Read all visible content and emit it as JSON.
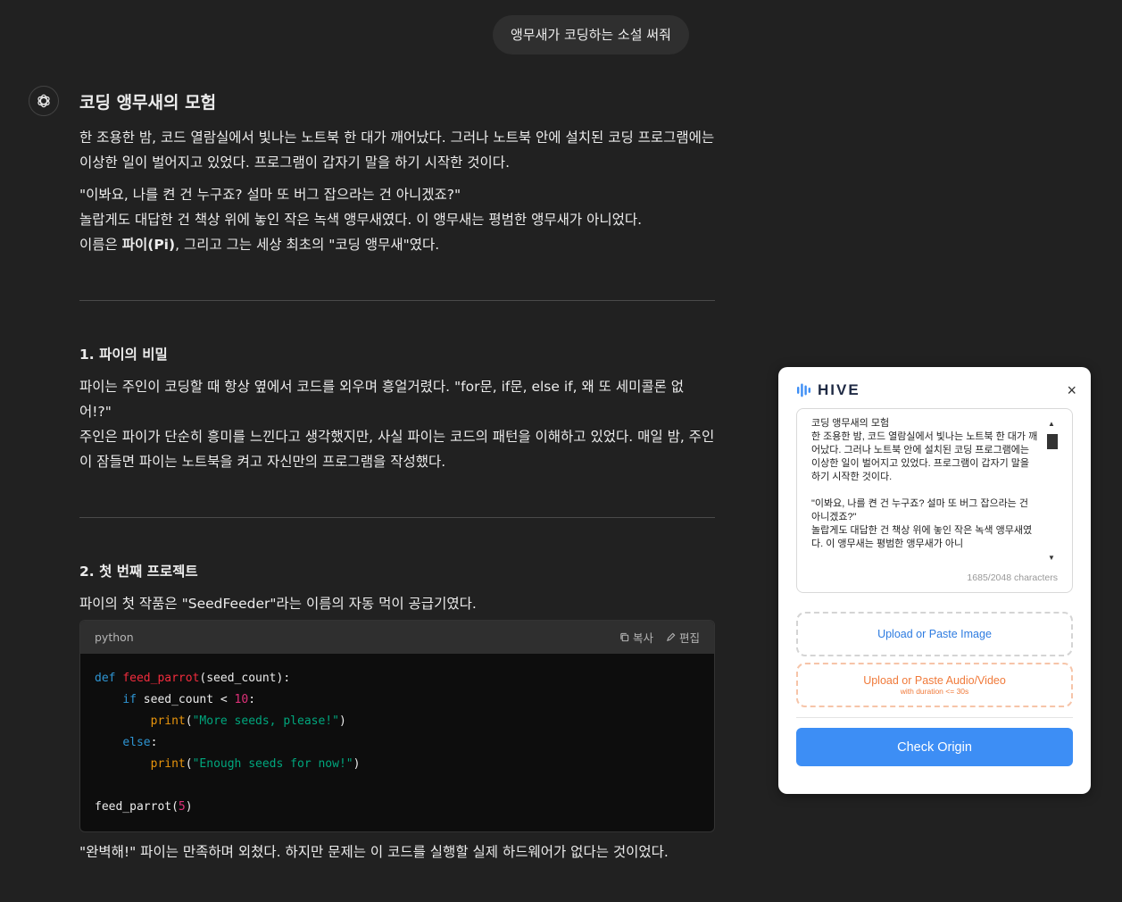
{
  "user_message": "앵무새가 코딩하는 소설 써줘",
  "answer": {
    "title": "코딩 앵무새의 모험",
    "intro_p1": "한 조용한 밤, 코드 열람실에서 빛나는 노트북 한 대가 깨어났다. 그러나 노트북 안에 설치된 코딩 프로그램에는 이상한 일이 벌어지고 있었다. 프로그램이 갑자기 말을 하기 시작한 것이다.",
    "intro_quote": "\"이봐요, 나를 켠 건 누구죠? 설마 또 버그 잡으라는 건 아니겠죠?\"",
    "intro_p2": "놀랍게도 대답한 건 책상 위에 놓인 작은 녹색 앵무새였다. 이 앵무새는 평범한 앵무새가 아니었다.",
    "intro_p3_a": "이름은 ",
    "intro_p3_bold": "파이(Pi)",
    "intro_p3_b": ", 그리고 그는 세상 최초의 \"코딩 앵무새\"였다.",
    "s1_title": "1. 파이의 비밀",
    "s1_p1": "파이는 주인이 코딩할 때 항상 옆에서 코드를 외우며 흥얼거렸다. \"for문, if문, else if, 왜 또 세미콜론 없어!?\"",
    "s1_p2": "주인은 파이가 단순히 흥미를 느낀다고 생각했지만, 사실 파이는 코드의 패턴을 이해하고 있었다. 매일 밤, 주인이 잠들면 파이는 노트북을 켜고 자신만의 프로그램을 작성했다.",
    "s2_title": "2. 첫 번째 프로젝트",
    "s2_p1": "파이의 첫 작품은 \"SeedFeeder\"라는 이름의 자동 먹이 공급기였다.",
    "after_code": "\"완벽해!\" 파이는 만족하며 외쳤다. 하지만 문제는 이 코드를 실행할 실제 하드웨어가 없다는 것이었다."
  },
  "code": {
    "language": "python",
    "copy_label": "복사",
    "edit_label": "편집",
    "l1_kw": "def",
    "l1_fn": "feed_parrot",
    "l1_rest": "(seed_count):",
    "l2_kw": "if",
    "l2_mid": " seed_count < ",
    "l2_num": "10",
    "l2_end": ":",
    "l3_bi": "print",
    "l3_open": "(",
    "l3_str": "\"More seeds, please!\"",
    "l3_close": ")",
    "l4_kw": "else",
    "l4_end": ":",
    "l5_bi": "print",
    "l5_open": "(",
    "l5_str": "\"Enough seeds for now!\"",
    "l5_close": ")",
    "l7_call": "feed_parrot(",
    "l7_num": "5",
    "l7_close": ")"
  },
  "hive": {
    "brand": "HIVE",
    "close": "×",
    "text_value": "코딩 앵무새의 모험\n한 조용한 밤, 코드 열람실에서 빛나는 노트북 한 대가 깨어났다. 그러나 노트북 안에 설치된 코딩 프로그램에는 이상한 일이 벌어지고 있었다. 프로그램이 갑자기 말을 하기 시작한 것이다.\n\n\"이봐요, 나를 켠 건 누구죠? 설마 또 버그 잡으라는 건 아니겠죠?\"\n놀랍게도 대답한 건 책상 위에 놓인 작은 녹색 앵무새였다. 이 앵무새는 평범한 앵무새가 아니",
    "char_count": "1685/2048 characters",
    "upload_image": "Upload or Paste Image",
    "upload_av": "Upload or Paste Audio/Video",
    "upload_av_sub": "with duration <= 30s",
    "check_button": "Check Origin",
    "brand_color": "#3d8ef5",
    "av_color": "#f07a3a"
  }
}
